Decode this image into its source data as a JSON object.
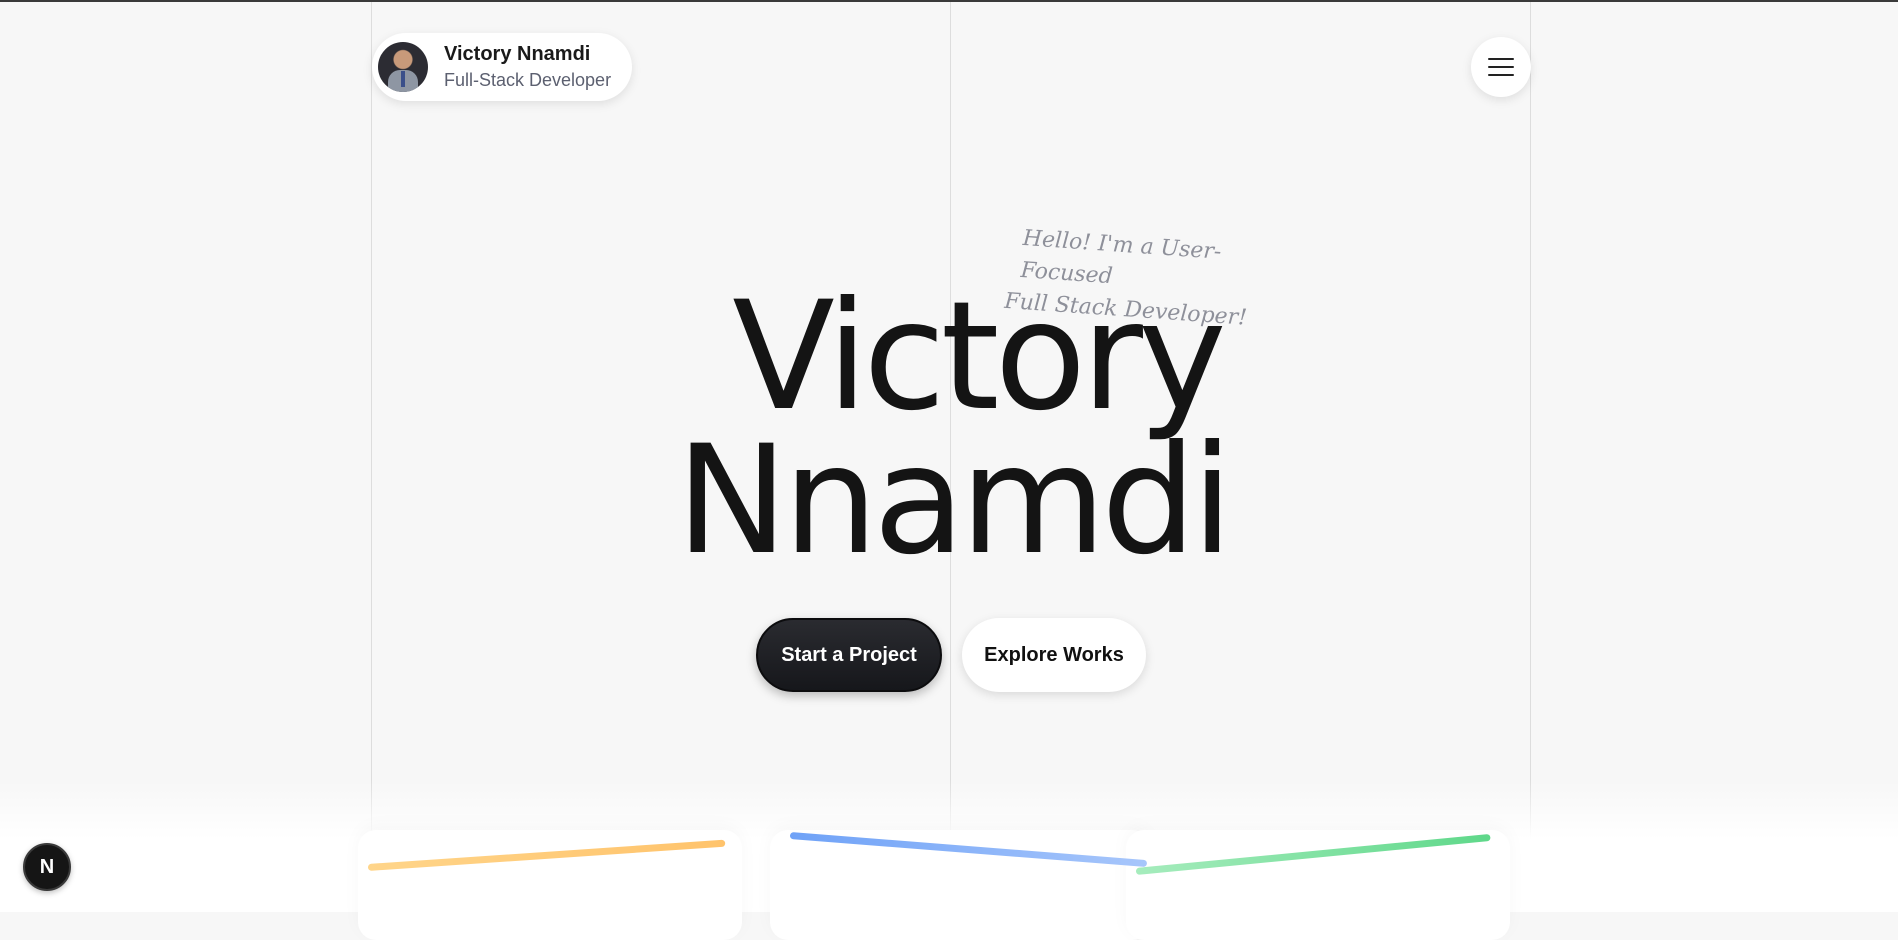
{
  "profile": {
    "name": "Victory Nnamdi",
    "role": "Full-Stack Developer"
  },
  "hero": {
    "tagline_line1": "Hello! I'm a User-Focused",
    "tagline_line2": "Full Stack Developer!",
    "first_name": "Victory",
    "last_name": "Nnamdi"
  },
  "actions": {
    "primary_label": "Start a Project",
    "secondary_label": "Explore Works"
  },
  "dev_badge": {
    "label": "N"
  },
  "icons": {
    "menu": "hamburger-menu-icon",
    "dev": "nextjs-indicator-icon"
  },
  "colors": {
    "background": "#f7f7f7",
    "text_primary": "#141414",
    "accent_yellow": "#ffc36b",
    "accent_blue": "#6fa2f7",
    "accent_green": "#5fd88a"
  }
}
